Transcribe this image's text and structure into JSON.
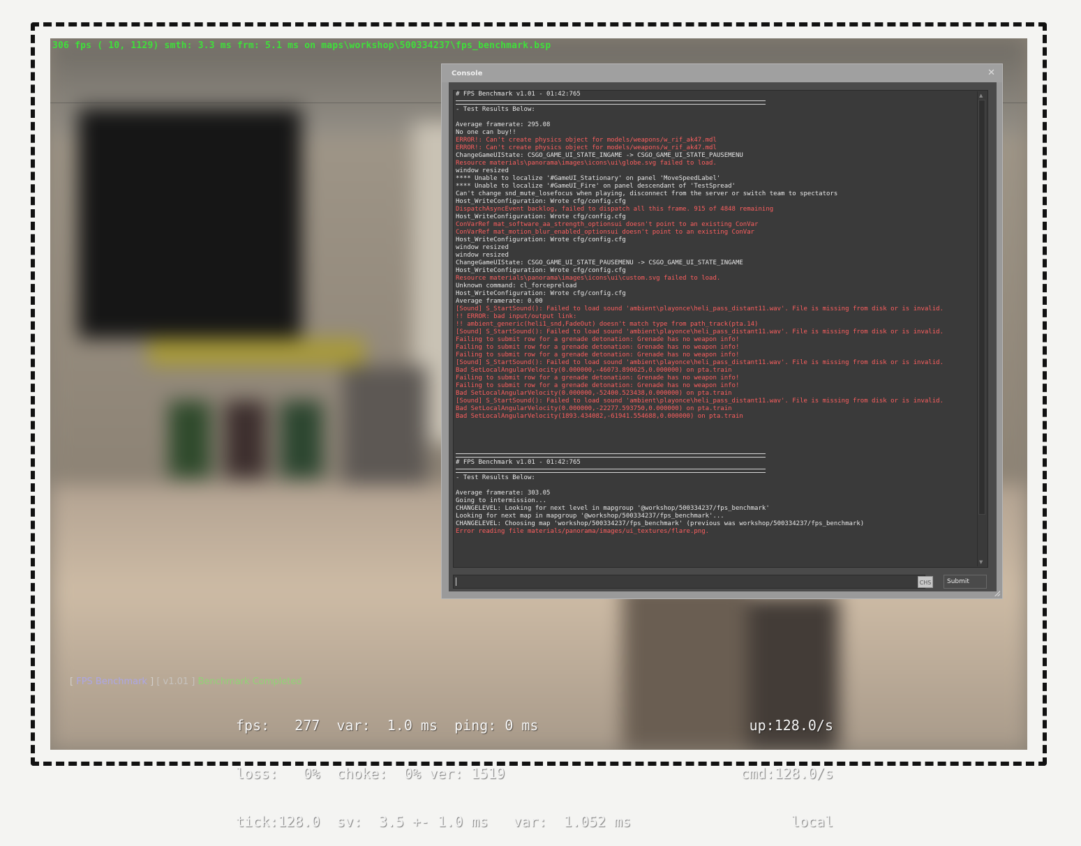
{
  "hud": {
    "fps_line": "306 fps ( 10, 1129) smth: 3.3 ms frm: 5.1 ms on maps\\workshop\\500334237\\fps_benchmark.bsp"
  },
  "console": {
    "title": "Console",
    "close_icon": "close-icon",
    "lines": [
      {
        "text": "# FPS Benchmark v1.01 - 01:42:765",
        "type": "normal"
      },
      {
        "text": "",
        "type": "rule"
      },
      {
        "text": "- Test Results Below:",
        "type": "normal"
      },
      {
        "text": "",
        "type": "normal"
      },
      {
        "text": "Average framerate: 295.08",
        "type": "normal"
      },
      {
        "text": "No one can buy!!",
        "type": "normal"
      },
      {
        "text": "ERROR!: Can't create physics object for models/weapons/w_rif_ak47.mdl",
        "type": "err"
      },
      {
        "text": "ERROR!: Can't create physics object for models/weapons/w_rif_ak47.mdl",
        "type": "err"
      },
      {
        "text": "ChangeGameUIState: CSGO_GAME_UI_STATE_INGAME -> CSGO_GAME_UI_STATE_PAUSEMENU",
        "type": "normal"
      },
      {
        "text": "Resource materials\\panorama\\images\\icons\\ui\\globe.svg failed to load.",
        "type": "err"
      },
      {
        "text": "window resized",
        "type": "normal"
      },
      {
        "text": "**** Unable to localize '#GameUI_Stationary' on panel 'MoveSpeedLabel'",
        "type": "normal"
      },
      {
        "text": "**** Unable to localize '#GameUI_Fire' on panel descendant of 'TestSpread'",
        "type": "normal"
      },
      {
        "text": "Can't change snd_mute_losefocus when playing, disconnect from the server or switch team to spectators",
        "type": "normal"
      },
      {
        "text": "Host_WriteConfiguration: Wrote cfg/config.cfg",
        "type": "normal"
      },
      {
        "text": "DispatchAsyncEvent backlog, failed to dispatch all this frame. 915 of 4848 remaining",
        "type": "err"
      },
      {
        "text": "Host_WriteConfiguration: Wrote cfg/config.cfg",
        "type": "normal"
      },
      {
        "text": "ConVarRef mat_software_aa_strength_optionsui doesn't point to an existing ConVar",
        "type": "err"
      },
      {
        "text": "ConVarRef mat_motion_blur_enabled_optionsui doesn't point to an existing ConVar",
        "type": "err"
      },
      {
        "text": "Host_WriteConfiguration: Wrote cfg/config.cfg",
        "type": "normal"
      },
      {
        "text": "window resized",
        "type": "normal"
      },
      {
        "text": "window resized",
        "type": "normal"
      },
      {
        "text": "ChangeGameUIState: CSGO_GAME_UI_STATE_PAUSEMENU -> CSGO_GAME_UI_STATE_INGAME",
        "type": "normal"
      },
      {
        "text": "Host_WriteConfiguration: Wrote cfg/config.cfg",
        "type": "normal"
      },
      {
        "text": "Resource materials\\panorama\\images\\icons\\ui\\custom.svg failed to load.",
        "type": "err"
      },
      {
        "text": "Unknown command: cl_forcepreload",
        "type": "normal"
      },
      {
        "text": "Host_WriteConfiguration: Wrote cfg/config.cfg",
        "type": "normal"
      },
      {
        "text": "Average framerate: 0.00",
        "type": "normal"
      },
      {
        "text": "[Sound] S_StartSound(): Failed to load sound 'ambient\\playonce\\heli_pass_distant11.wav'. File is missing from disk or is invalid.",
        "type": "err"
      },
      {
        "text": "!! ERROR: bad input/output link:",
        "type": "err"
      },
      {
        "text": "!! ambient_generic(heli1_snd,FadeOut) doesn't match type from path_track(pta.14)",
        "type": "err"
      },
      {
        "text": "[Sound] S_StartSound(): Failed to load sound 'ambient\\playonce\\heli_pass_distant11.wav'. File is missing from disk or is invalid.",
        "type": "err"
      },
      {
        "text": "Failing to submit row for a grenade detonation: Grenade has no weapon info!",
        "type": "err"
      },
      {
        "text": "Failing to submit row for a grenade detonation: Grenade has no weapon info!",
        "type": "err"
      },
      {
        "text": "Failing to submit row for a grenade detonation: Grenade has no weapon info!",
        "type": "err"
      },
      {
        "text": "[Sound] S_StartSound(): Failed to load sound 'ambient\\playonce\\heli_pass_distant11.wav'. File is missing from disk or is invalid.",
        "type": "err"
      },
      {
        "text": "Bad SetLocalAngularVelocity(0.000000,-46073.890625,0.000000) on pta.train",
        "type": "err"
      },
      {
        "text": "Failing to submit row for a grenade detonation: Grenade has no weapon info!",
        "type": "err"
      },
      {
        "text": "Failing to submit row for a grenade detonation: Grenade has no weapon info!",
        "type": "err"
      },
      {
        "text": "Bad SetLocalAngularVelocity(0.000000,-52400.523438,0.000000) on pta.train",
        "type": "err"
      },
      {
        "text": "[Sound] S_StartSound(): Failed to load sound 'ambient\\playonce\\heli_pass_distant11.wav'. File is missing from disk or is invalid.",
        "type": "err"
      },
      {
        "text": "Bad SetLocalAngularVelocity(0.000000,-22277.593750,0.000000) on pta.train",
        "type": "err"
      },
      {
        "text": "Bad SetLocalAngularVelocity(1893.434082,-61941.554688,0.000000) on pta.train",
        "type": "err"
      },
      {
        "text": "",
        "type": "normal"
      },
      {
        "text": "",
        "type": "normal"
      },
      {
        "text": "",
        "type": "normal"
      },
      {
        "text": "",
        "type": "normal"
      },
      {
        "text": "",
        "type": "rule"
      },
      {
        "text": "# FPS Benchmark v1.01 - 01:42:765",
        "type": "normal"
      },
      {
        "text": "",
        "type": "rule"
      },
      {
        "text": "- Test Results Below:",
        "type": "normal"
      },
      {
        "text": "",
        "type": "normal"
      },
      {
        "text": "Average framerate: 303.05",
        "type": "normal"
      },
      {
        "text": "Going to intermission...",
        "type": "normal"
      },
      {
        "text": "CHANGELEVEL: Looking for next level in mapgroup '@workshop/500334237/fps_benchmark'",
        "type": "normal"
      },
      {
        "text": "Looking for next map in mapgroup '@workshop/500334237/fps_benchmark'...",
        "type": "normal"
      },
      {
        "text": "CHANGELEVEL: Choosing map 'workshop/500334237/fps_benchmark' (previous was workshop/500334237/fps_benchmark)",
        "type": "normal"
      },
      {
        "text": "Error reading file materials/panorama/images/ui_textures/flare.png.",
        "type": "err"
      }
    ],
    "input": {
      "value": ""
    },
    "ime_label": "CHS",
    "submit_label": "Submit"
  },
  "benchmark": {
    "open_bracket": "[",
    "name": "FPS Benchmark",
    "close_bracket": "]",
    "version": "[ v1.01 ]",
    "status": "Benchmark Completed"
  },
  "netgraph": {
    "left": [
      "fps:   277  var:  1.0 ms  ping: 0 ms",
      "loss:   0%  choke:  0% ver: 1519",
      "tick:128.0  sv:  3.5 +- 1.0 ms   var:  1.052 ms"
    ],
    "right": [
      "up:128.0/s",
      "cmd:128.0/s",
      "local"
    ]
  },
  "colors": {
    "fps_text": "#3fe03a",
    "error_text": "#ff5f5f",
    "console_bg": "#3a3a3a"
  }
}
